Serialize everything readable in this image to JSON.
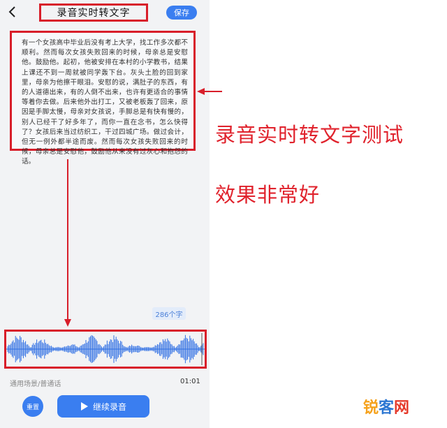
{
  "header": {
    "back_icon": "chevron-left-icon",
    "title": "录音实时转文字",
    "save_label": "保存"
  },
  "transcript": {
    "text": "有一个女孩高中毕业后没有考上大学，找工作多次都不顺利。然而每次女孩失败回来的时候，母亲总是安慰他。鼓励他。起初，他被安排在本村的小学教书，结果上课还不到一周就被同学轰下台。灰头土脸的回到家里，母亲为他擦干眼泪。安慰的说，满肚子的东西，有的人道德出来，有的人倒不出来，也许有更适合的事情等着你去做。后来他外出打工，又被老板轰了回来，原因是手脚太慢，母亲对女孩说，手脚总是有快有慢的，别人已经干了好多年了，而你一直在念书，怎么快得了？女孩后来当过纺织工，干过四城广场。做过会计，但无一例外都半途而废。然而每次女孩失败回来的时候，母亲总是安慰他，鼓励他从来没有过灰心和抱怨的话。",
    "char_count": "286个字"
  },
  "recorder": {
    "scene": "通用场景/普通话",
    "time": "01:01",
    "reset_label": "重置",
    "continue_label": "继续录音",
    "continue_icon": "play-icon"
  },
  "annotations": {
    "line1": "录音实时转文字测试",
    "line2": "效果非常好"
  },
  "watermark": {
    "part1": "锐",
    "part2": "客",
    "part3": "网"
  },
  "colors": {
    "accent_blue": "#3a7ef0",
    "annotation_red": "#e0222c",
    "wave_blue": "#2f6fe4"
  }
}
